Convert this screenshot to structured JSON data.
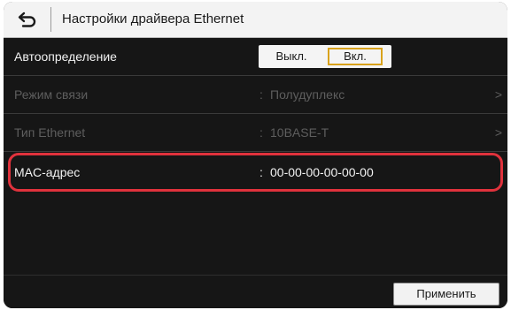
{
  "header": {
    "back_icon": "back-arrow-icon",
    "title": "Настройки драйвера Ethernet"
  },
  "rows": [
    {
      "label": "Автоопределение",
      "enabled": true,
      "toggle": {
        "off_label": "Выкл.",
        "on_label": "Вкл.",
        "selected": "Вкл."
      }
    },
    {
      "label": "Режим связи",
      "enabled": false,
      "colon": ":",
      "value": "Полудуплекс",
      "chevron": ">"
    },
    {
      "label": "Тип Ethernet",
      "enabled": false,
      "colon": ":",
      "value": "10BASE-T",
      "chevron": ">"
    },
    {
      "label": "MAC-адрес",
      "enabled": true,
      "colon": ":",
      "value": "00-00-00-00-00-00",
      "highlighted": true
    }
  ],
  "footer": {
    "apply_label": "Применить"
  },
  "colors": {
    "highlight": "#e0323c",
    "toggle_selected_border": "#d9a21b",
    "background": "#161616"
  }
}
